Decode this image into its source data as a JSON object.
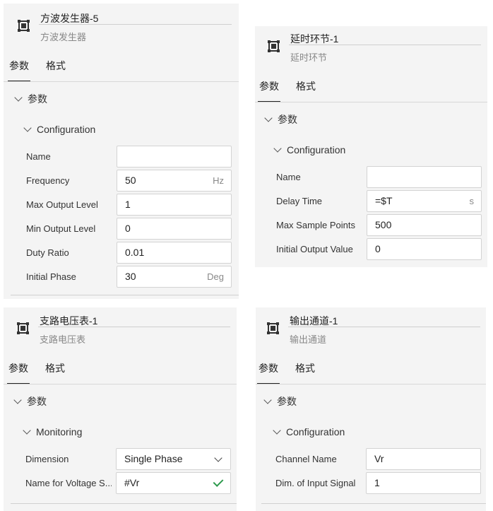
{
  "panels": {
    "square_wave": {
      "title": "方波发生器-5",
      "subtitle": "方波发生器",
      "tabs": [
        "参数",
        "格式"
      ],
      "section": "参数",
      "group": "Configuration",
      "fields": [
        {
          "label": "Name",
          "value": "",
          "unit": ""
        },
        {
          "label": "Frequency",
          "value": "50",
          "unit": "Hz"
        },
        {
          "label": "Max Output Level",
          "value": "1",
          "unit": ""
        },
        {
          "label": "Min Output Level",
          "value": "0",
          "unit": ""
        },
        {
          "label": "Duty Ratio",
          "value": "0.01",
          "unit": ""
        },
        {
          "label": "Initial Phase",
          "value": "30",
          "unit": "Deg"
        }
      ]
    },
    "delay": {
      "title": "延时环节-1",
      "subtitle": "延时环节",
      "tabs": [
        "参数",
        "格式"
      ],
      "section": "参数",
      "group": "Configuration",
      "fields": [
        {
          "label": "Name",
          "value": "",
          "unit": ""
        },
        {
          "label": "Delay Time",
          "value": "=$T",
          "unit": "s"
        },
        {
          "label": "Max Sample Points",
          "value": "500",
          "unit": ""
        },
        {
          "label": "Initial Output Value",
          "value": "0",
          "unit": ""
        }
      ]
    },
    "voltmeter": {
      "title": "支路电压表-1",
      "subtitle": "支路电压表",
      "tabs": [
        "参数",
        "格式"
      ],
      "section": "参数",
      "group": "Monitoring",
      "fields": [
        {
          "label": "Dimension",
          "value": "Single Phase",
          "type": "dropdown"
        },
        {
          "label": "Name for Voltage S...",
          "value": "#Vr",
          "type": "valid"
        }
      ]
    },
    "output_channel": {
      "title": "输出通道-1",
      "subtitle": "输出通道",
      "tabs": [
        "参数",
        "格式"
      ],
      "section": "参数",
      "group": "Configuration",
      "fields": [
        {
          "label": "Channel Name",
          "value": "Vr"
        },
        {
          "label": "Dim. of Input Signal",
          "value": "1"
        }
      ]
    }
  },
  "icons": {
    "component": "component-node-icon",
    "expand": "chevron-down-icon",
    "dropdown": "chevron-down-icon",
    "valid": "checkmark-icon"
  },
  "colors": {
    "panel_bg": "#f4f4f4",
    "valid_check": "#2e9a4e"
  }
}
